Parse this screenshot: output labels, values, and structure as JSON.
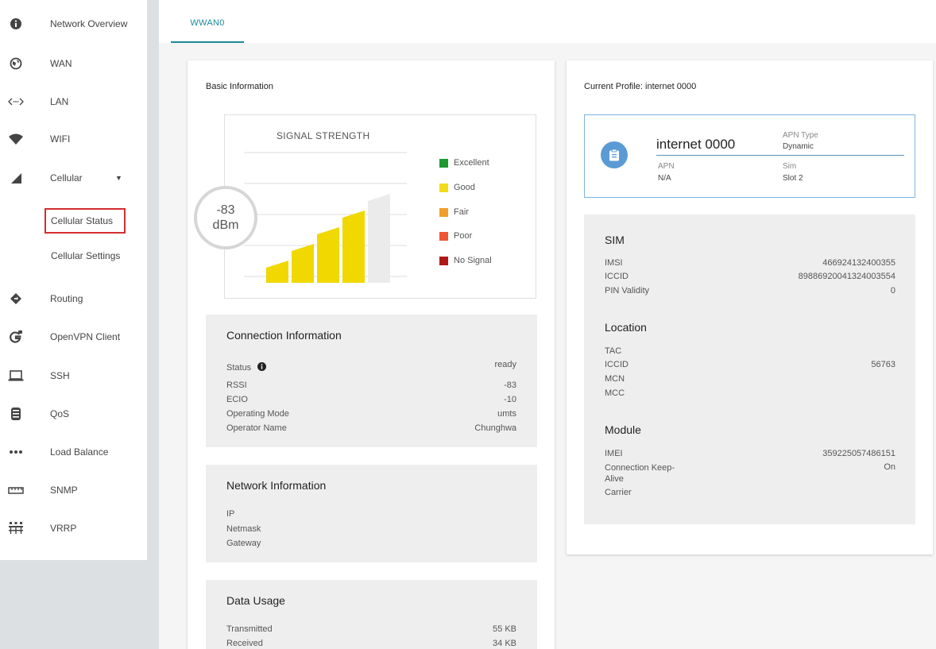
{
  "sidebar": {
    "items": [
      {
        "label": "Network Overview",
        "icon": "info-icon"
      },
      {
        "label": "WAN",
        "icon": "globe-icon"
      },
      {
        "label": "LAN",
        "icon": "code-arrows-icon"
      },
      {
        "label": "WIFI",
        "icon": "wifi-icon"
      },
      {
        "label": "Cellular",
        "icon": "signal-icon"
      },
      {
        "label": "Cellular Status",
        "icon": ""
      },
      {
        "label": "Cellular Settings",
        "icon": ""
      },
      {
        "label": "Routing",
        "icon": "routing-diamond-icon"
      },
      {
        "label": "OpenVPN Client",
        "icon": "vpn-icon"
      },
      {
        "label": "SSH",
        "icon": "laptop-icon"
      },
      {
        "label": "QoS",
        "icon": "qos-icon"
      },
      {
        "label": "Load Balance",
        "icon": "dots-icon"
      },
      {
        "label": "SNMP",
        "icon": "snmp-ruler-icon"
      },
      {
        "label": "VRRP",
        "icon": "vrrp-network-icon"
      }
    ]
  },
  "tabs": [
    {
      "label": "WWAN0",
      "active": true
    }
  ],
  "basic": {
    "title": "Basic Information",
    "chart_title": "SIGNAL STRENGTH",
    "rssi_value": "-83",
    "rssi_unit": "dBm",
    "bars_filled": 4,
    "bars_total": 5,
    "legend": [
      {
        "label": "Excellent",
        "color": "#1e9a2e"
      },
      {
        "label": "Good",
        "color": "#f2dc1a"
      },
      {
        "label": "Fair",
        "color": "#f0a02a"
      },
      {
        "label": "Poor",
        "color": "#ee5533"
      },
      {
        "label": "No Signal",
        "color": "#b01818"
      }
    ],
    "bar_color": "#f0d800",
    "bar_empty_color": "#ebebeb"
  },
  "connection": {
    "title": "Connection Information",
    "rows": [
      {
        "label": "Status",
        "value": "ready"
      },
      {
        "label": "RSSI",
        "value": "-83"
      },
      {
        "label": "ECIO",
        "value": "-10"
      },
      {
        "label": "Operating Mode",
        "value": "umts"
      },
      {
        "label": "Operator Name",
        "value": "Chunghwa"
      }
    ]
  },
  "network": {
    "title": "Network Information",
    "rows": [
      {
        "label": "IP",
        "value": ""
      },
      {
        "label": "Netmask",
        "value": ""
      },
      {
        "label": "Gateway",
        "value": ""
      }
    ]
  },
  "data_usage": {
    "title": "Data Usage",
    "rows": [
      {
        "label": "Transmitted",
        "value": "55 KB"
      },
      {
        "label": "Received",
        "value": "34 KB"
      }
    ]
  },
  "profile": {
    "header": "Current Profile: internet 0000",
    "name": "internet 0000",
    "apn_type_label": "APN Type",
    "apn_type_value": "Dynamic",
    "apn_label": "APN",
    "apn_value": "N/A",
    "sim_label": "Sim",
    "sim_value": "Slot 2"
  },
  "sim": {
    "title": "SIM",
    "rows": [
      {
        "label": "IMSI",
        "value": "466924132400355"
      },
      {
        "label": "ICCID",
        "value": "89886920041324003554"
      },
      {
        "label": "PIN Validity",
        "value": "0"
      }
    ]
  },
  "location": {
    "title": "Location",
    "rows": [
      {
        "label": "TAC",
        "value": ""
      },
      {
        "label": "ICCID",
        "value": "56763"
      },
      {
        "label": "MCN",
        "value": ""
      },
      {
        "label": "MCC",
        "value": ""
      }
    ]
  },
  "module": {
    "title": "Module",
    "rows": [
      {
        "label": "IMEI",
        "value": "359225057486151"
      },
      {
        "label": "Connection Keep-Alive",
        "value": "On"
      },
      {
        "label": "Carrier",
        "value": ""
      }
    ]
  }
}
